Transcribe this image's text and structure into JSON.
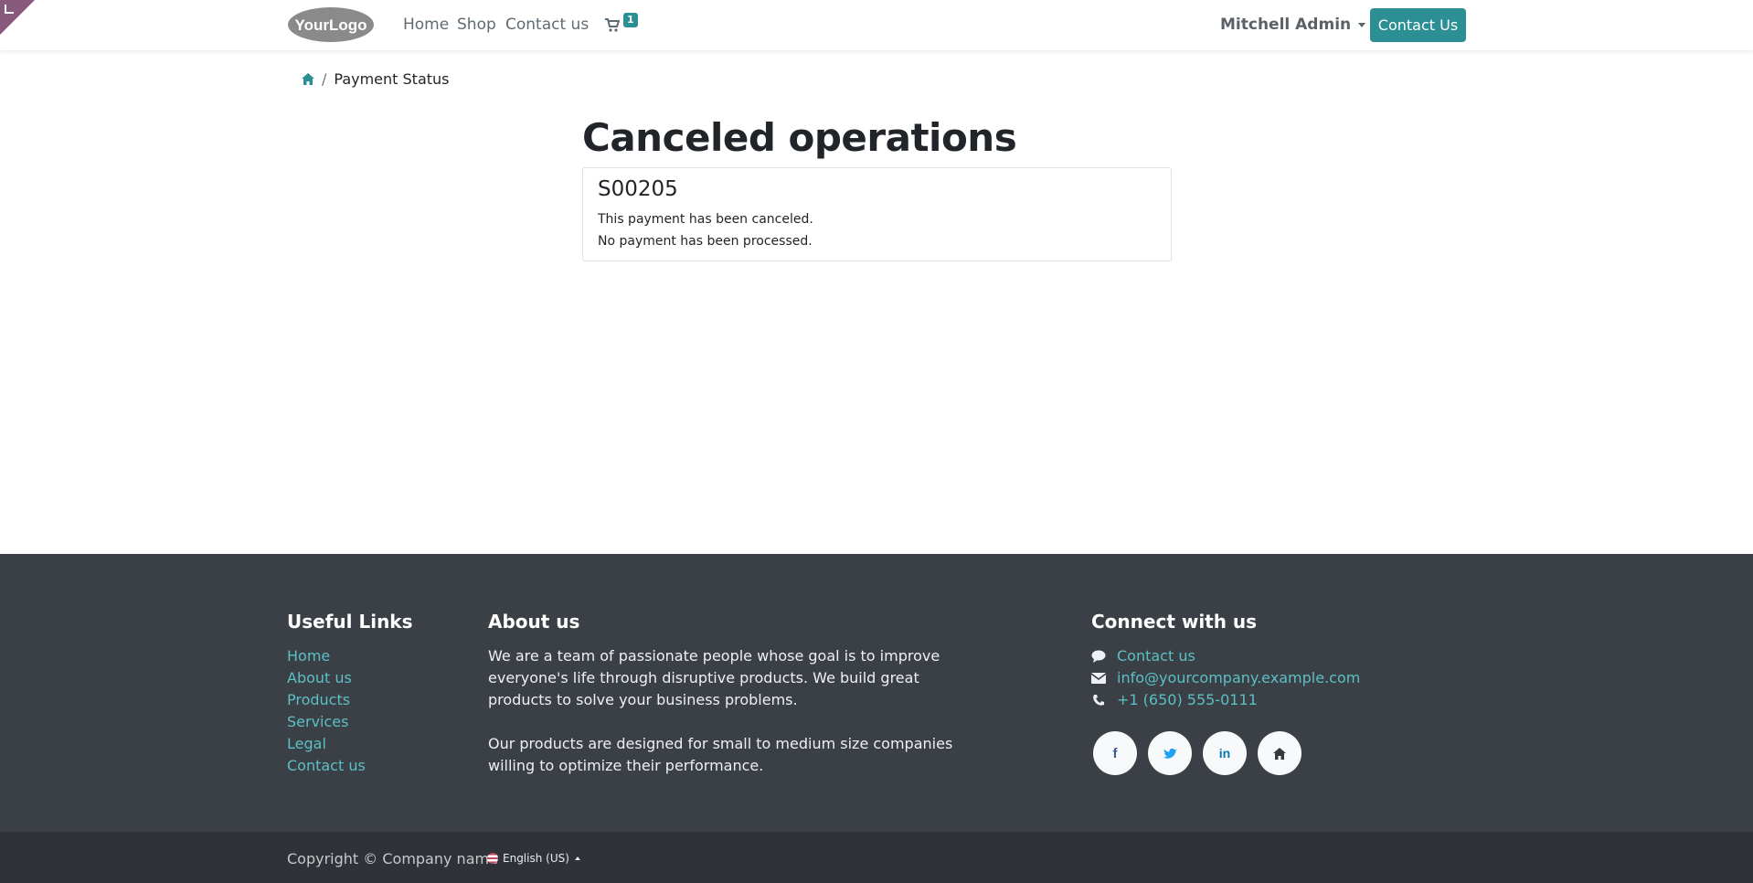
{
  "header": {
    "logo_text": "YourLogo",
    "nav": [
      "Home",
      "Shop",
      "Contact us"
    ],
    "cart_count": "1",
    "user_name": "Mitchell Admin",
    "cta_label": "Contact Us"
  },
  "breadcrumb": {
    "home_icon": "home-icon",
    "current": "Payment Status"
  },
  "main": {
    "title": "Canceled operations",
    "order_ref": "S00205",
    "line1": "This payment has been canceled.",
    "line2": "No payment has been processed."
  },
  "footer": {
    "useful_links_title": "Useful Links",
    "useful_links": [
      "Home",
      "About us",
      "Products",
      "Services",
      "Legal",
      "Contact us"
    ],
    "about_title": "About us",
    "about_p1": "We are a team of passionate people whose goal is to improve everyone's life through disruptive products. We build great products to solve your business problems.",
    "about_p2": "Our products are designed for small to medium size companies willing to optimize their performance.",
    "connect_title": "Connect with us",
    "contact_link": "Contact us",
    "email": "info@yourcompany.example.com",
    "phone": "+1 (650) 555-0111",
    "socials": [
      "facebook-icon",
      "twitter-icon",
      "linkedin-icon",
      "home-icon"
    ]
  },
  "bottom": {
    "copyright": "Copyright © Company name",
    "language": "English (US)"
  },
  "colors": {
    "accent": "#2c8f94",
    "link": "#5bc0c5",
    "footer_bg": "#3b3f46",
    "bottom_bg": "#2f3238",
    "corner": "#875a7b"
  }
}
